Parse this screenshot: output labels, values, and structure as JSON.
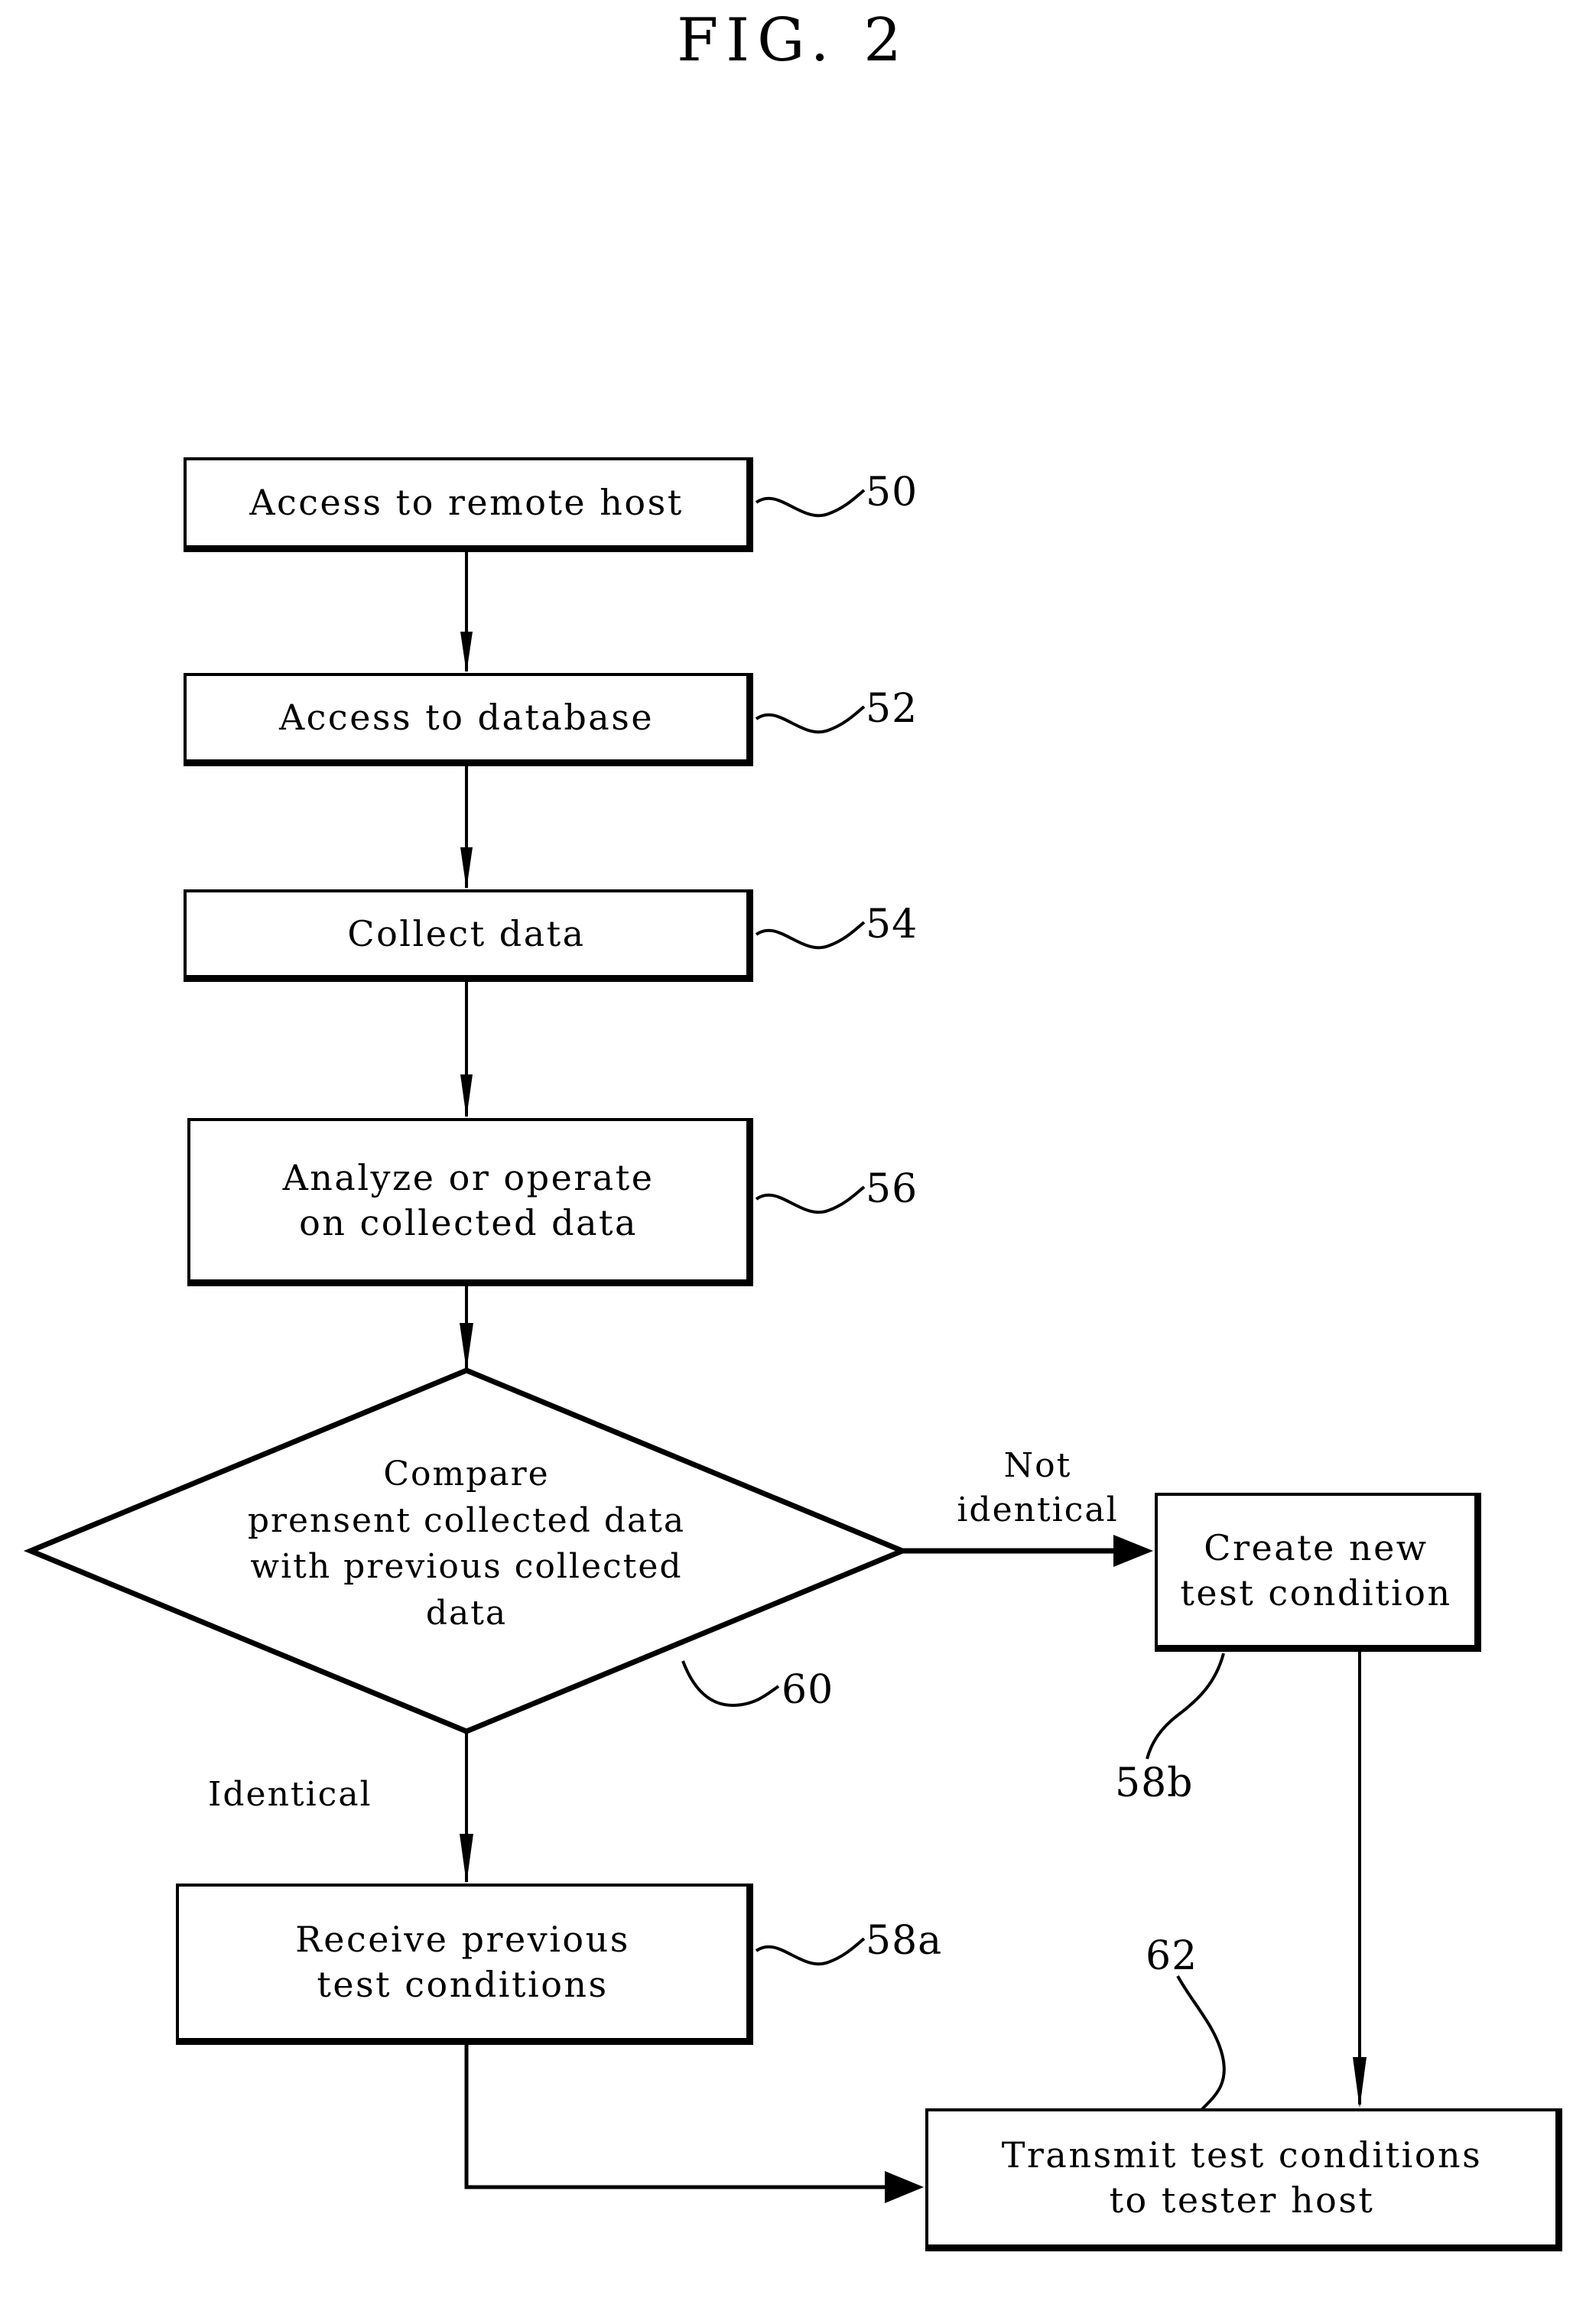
{
  "figure": {
    "title": "FIG. 2",
    "kind": "patent-flowchart"
  },
  "nodes": {
    "access_remote_host": {
      "label": "Access to remote host",
      "ref": "50"
    },
    "access_database": {
      "label": "Access to database",
      "ref": "52"
    },
    "collect_data": {
      "label": "Collect data",
      "ref": "54"
    },
    "analyze_operate": {
      "label": "Analyze or operate\non collected data",
      "ref": "56"
    },
    "compare_decision": {
      "label": "Compare\nprensent collected data\nwith previous collected\ndata",
      "ref": "60"
    },
    "create_new_condition": {
      "label": "Create new\ntest condition",
      "ref": "58b"
    },
    "receive_previous_conditions": {
      "label": "Receive previous\ntest conditions",
      "ref": "58a"
    },
    "transmit_conditions": {
      "label": "Transmit test conditions\nto tester host",
      "ref": "62"
    }
  },
  "edge_labels": {
    "not_identical": "Not\nidentical",
    "identical": "Identical"
  },
  "colors": {
    "ink": "#000000",
    "paper": "#ffffff"
  }
}
